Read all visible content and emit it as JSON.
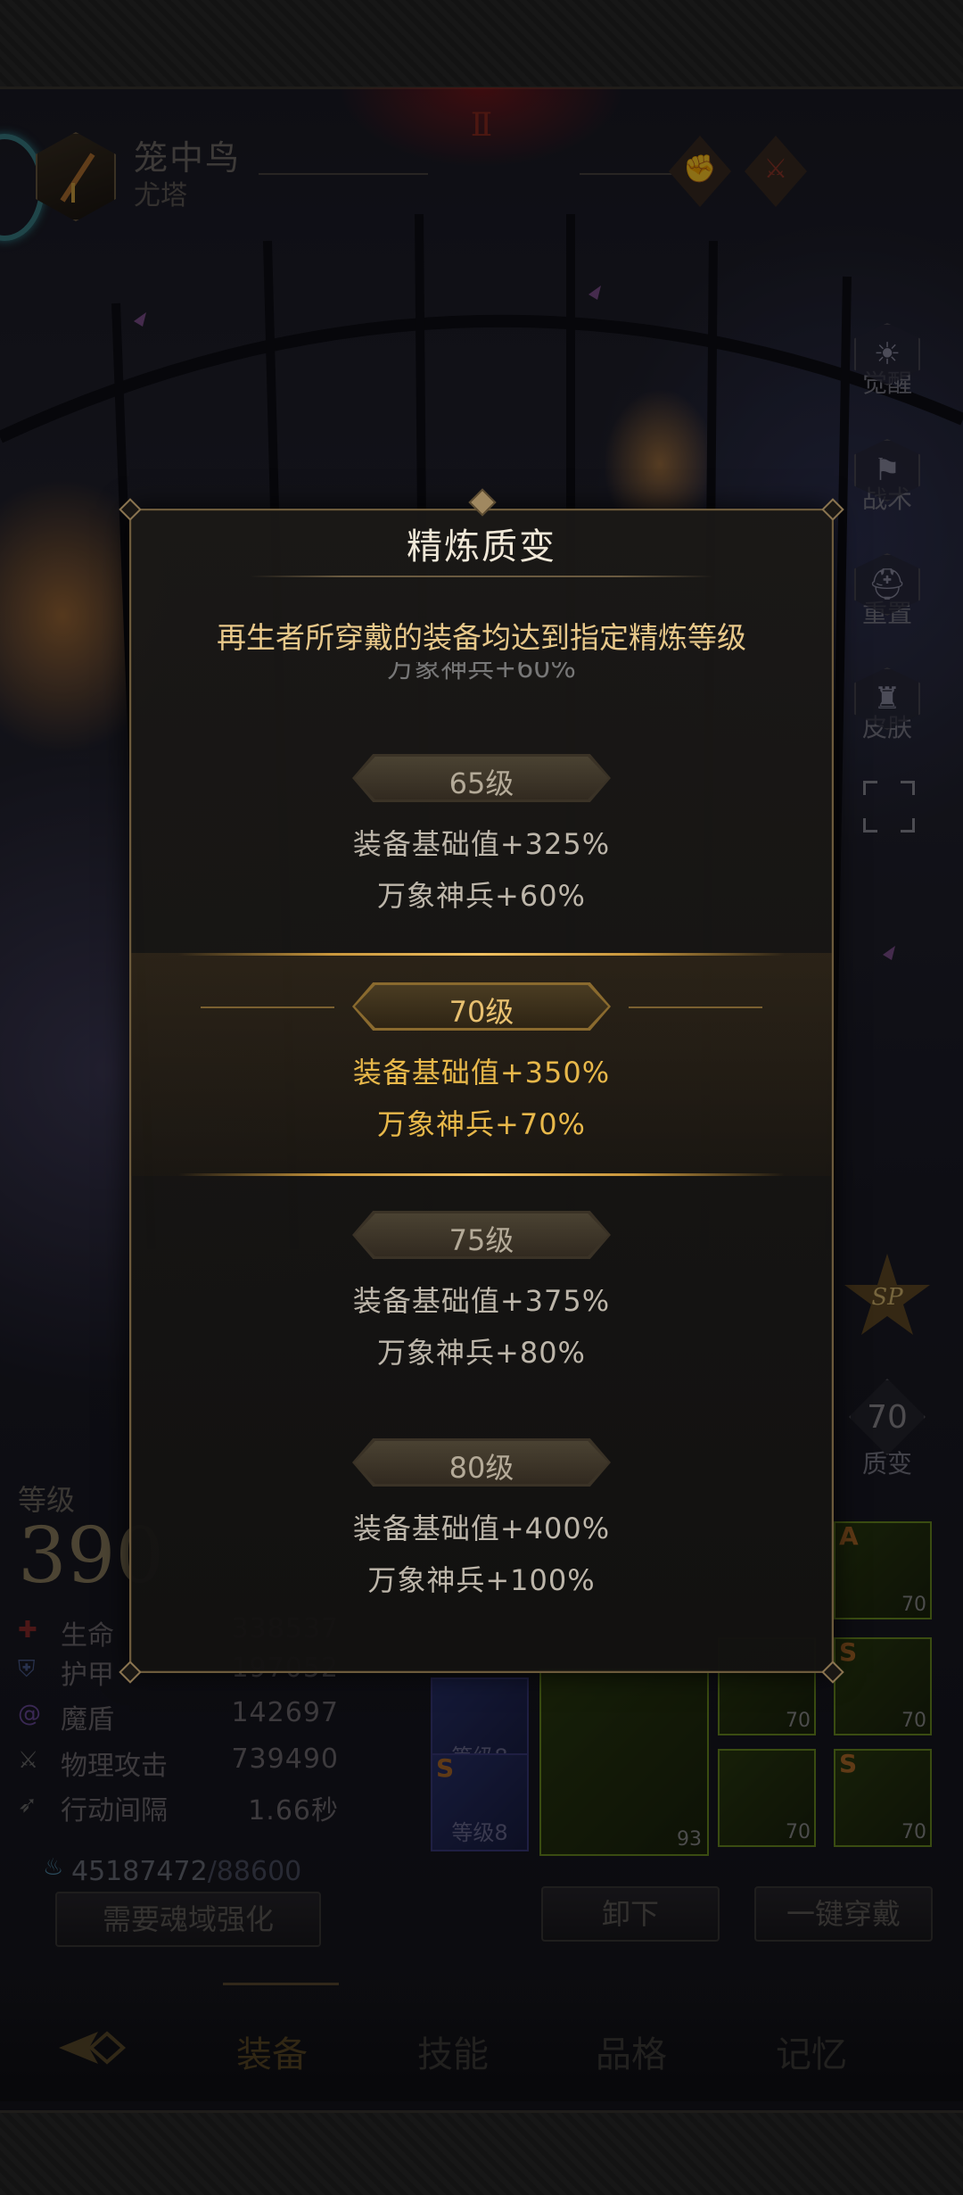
{
  "header": {
    "char_name": "笼中鸟",
    "char_sub": "尤塔"
  },
  "side_buttons": [
    "觉醒",
    "战术",
    "重置",
    "皮肤"
  ],
  "sp_badge": "SP",
  "level_badge": {
    "value": "70",
    "label": "质变"
  },
  "stats": {
    "level_label": "等级",
    "level_value": "390",
    "items": [
      {
        "name": "生命",
        "value": "338537",
        "icon": "cross-icon",
        "color": "#8a2a2a"
      },
      {
        "name": "护甲",
        "value": "197052",
        "icon": "shield-icon",
        "color": "#4a5a8a"
      },
      {
        "name": "魔盾",
        "value": "142697",
        "icon": "swirl-icon",
        "color": "#6a4a9a"
      },
      {
        "name": "物理攻击",
        "value": "739490",
        "icon": "sword-icon",
        "color": "#6a6a6a"
      },
      {
        "name": "行动间隔",
        "value": "1.66秒",
        "icon": "wing-icon",
        "color": "#6a6a6a"
      }
    ],
    "soul_current": "45187472",
    "soul_max": "/88600",
    "soul_button": "需要魂域强化"
  },
  "equipment": {
    "slots": [
      {
        "grade": "A",
        "count": "70"
      },
      {
        "grade": "S",
        "count": "70"
      },
      {
        "grade": "",
        "count": "70"
      },
      {
        "grade": "S",
        "count": "70"
      },
      {
        "grade": "",
        "count": "70"
      },
      {
        "grade": "S",
        "count": "70"
      }
    ],
    "gems": [
      {
        "grade": "",
        "level": "等级8"
      },
      {
        "grade": "S",
        "level": "等级8"
      }
    ],
    "weapon_count": "93",
    "unequip_button": "卸下",
    "equip_all_button": "一键穿戴"
  },
  "tabs": [
    "装备",
    "技能",
    "品格",
    "记忆"
  ],
  "modal": {
    "title": "精炼质变",
    "description": "再生者所穿戴的装备均达到指定精炼等级",
    "tiers": [
      {
        "level": "65级",
        "line1": "装备基础值+325%",
        "line2": "万象神兵+60%",
        "active": false
      },
      {
        "level": "70级",
        "line1": "装备基础值+350%",
        "line2": "万象神兵+70%",
        "active": true
      },
      {
        "level": "75级",
        "line1": "装备基础值+375%",
        "line2": "万象神兵+80%",
        "active": false
      },
      {
        "level": "80级",
        "line1": "装备基础值+400%",
        "line2": "万象神兵+100%",
        "active": false
      }
    ]
  },
  "colors": {
    "active_gold": "#e8b84a",
    "modal_border": "#6c5a3c",
    "desc_text": "#e8c88a"
  }
}
